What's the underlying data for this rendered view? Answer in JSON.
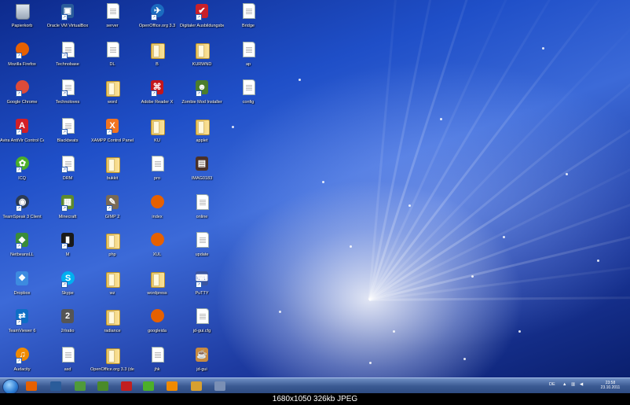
{
  "desktop": {
    "icons": [
      {
        "label": "Papierkorb",
        "type": "recycle",
        "color": "#9aa7b8"
      },
      {
        "label": "Mozilla Firefox",
        "type": "circ",
        "color": "#e66000",
        "glyph": "",
        "shortcut": true
      },
      {
        "label": "Google Chrome",
        "type": "circ",
        "color": "#dd4b39",
        "glyph": "",
        "shortcut": true
      },
      {
        "label": "Avira AntiVir Control Center",
        "type": "sq",
        "color": "#d31f26",
        "glyph": "A",
        "shortcut": true
      },
      {
        "label": "ICQ",
        "type": "circ",
        "color": "#4caf2a",
        "glyph": "✿",
        "shortcut": true
      },
      {
        "label": "TeamSpeak 3 Client",
        "type": "circ",
        "color": "#2b3b55",
        "glyph": "◉",
        "shortcut": true
      },
      {
        "label": "NetbeansLL",
        "type": "sq",
        "color": "#3a8c3a",
        "glyph": "◆",
        "shortcut": true
      },
      {
        "label": "Dropbox",
        "type": "sq",
        "color": "#3d8be0",
        "glyph": "❖",
        "shortcut": false
      },
      {
        "label": "TeamViewer 6",
        "type": "sq",
        "color": "#0e6ec6",
        "glyph": "⇄",
        "shortcut": true
      },
      {
        "label": "Audacity",
        "type": "circ",
        "color": "#f08a00",
        "glyph": "♫",
        "shortcut": true
      },
      {
        "label": "Oracle VM VirtualBox",
        "type": "sq",
        "color": "#2a5c9a",
        "glyph": "▣",
        "shortcut": true
      },
      {
        "label": "Technobase",
        "type": "doc",
        "color": "#ffffff",
        "shortcut": true
      },
      {
        "label": "Technoloves",
        "type": "doc",
        "color": "#ffffff",
        "shortcut": true
      },
      {
        "label": "Blackbeats",
        "type": "doc",
        "color": "#ffffff",
        "shortcut": true
      },
      {
        "label": "DRM",
        "type": "doc",
        "color": "#ffffff",
        "shortcut": true
      },
      {
        "label": "Minecraft",
        "type": "sq",
        "color": "#5d8a2e",
        "glyph": "▦",
        "shortcut": true
      },
      {
        "label": "M",
        "type": "sq",
        "color": "#1a1a1a",
        "glyph": "▮",
        "shortcut": true
      },
      {
        "label": "Skype",
        "type": "circ",
        "color": "#00aff0",
        "glyph": "S",
        "shortcut": true
      },
      {
        "label": "2rlratio",
        "type": "sq",
        "color": "#555555",
        "glyph": "2",
        "shortcut": false
      },
      {
        "label": "asd",
        "type": "doc",
        "color": "#ffffff",
        "shortcut": false
      },
      {
        "label": "server",
        "type": "doc",
        "color": "#ffffff",
        "shortcut": false
      },
      {
        "label": "DL",
        "type": "doc",
        "color": "#ffffff",
        "shortcut": false
      },
      {
        "label": "word",
        "type": "folder",
        "color": "#e9c560"
      },
      {
        "label": "XAMPP Control Panel",
        "type": "sq",
        "color": "#f37420",
        "glyph": "X",
        "shortcut": true
      },
      {
        "label": "bukkit",
        "type": "folder",
        "color": "#e9c560"
      },
      {
        "label": "GIMP 2",
        "type": "sq",
        "color": "#7a6a55",
        "glyph": "✎",
        "shortcut": true
      },
      {
        "label": "php",
        "type": "folder",
        "color": "#e9c560"
      },
      {
        "label": "wz",
        "type": "folder",
        "color": "#e9c560"
      },
      {
        "label": "radiance",
        "type": "folder",
        "color": "#e9c560"
      },
      {
        "label": "OpenOffice.org 3.3 (de) Installation Files",
        "type": "folder",
        "color": "#e9c560"
      },
      {
        "label": "OpenOffice.org 3.3",
        "type": "circ",
        "color": "#1b6bbf",
        "glyph": "✈",
        "shortcut": true
      },
      {
        "label": "B",
        "type": "folder",
        "color": "#e9c560"
      },
      {
        "label": "Adobe Reader X",
        "type": "sq",
        "color": "#c4161c",
        "glyph": "⌘",
        "shortcut": true
      },
      {
        "label": "KU",
        "type": "folder",
        "color": "#e9c560"
      },
      {
        "label": "pro",
        "type": "doc",
        "color": "#ffffff",
        "shortcut": false
      },
      {
        "label": "index",
        "type": "circ",
        "color": "#e66000",
        "glyph": "",
        "shortcut": false
      },
      {
        "label": "XUL",
        "type": "circ",
        "color": "#e66000",
        "glyph": "",
        "shortcut": false
      },
      {
        "label": "wordpress",
        "type": "folder",
        "color": "#e9c560"
      },
      {
        "label": "googleida",
        "type": "circ",
        "color": "#e66000",
        "glyph": "",
        "shortcut": false
      },
      {
        "label": "jhk",
        "type": "doc",
        "color": "#ffffff",
        "shortcut": false
      },
      {
        "label": "Digitaler Ausbildungsbericht...",
        "type": "sq",
        "color": "#c8202a",
        "glyph": "✔",
        "shortcut": true
      },
      {
        "label": "KURWND",
        "type": "folder",
        "color": "#e9c560"
      },
      {
        "label": "Zombie Mod Installer",
        "type": "sq",
        "color": "#4b7d2c",
        "glyph": "☻",
        "shortcut": true
      },
      {
        "label": "applet",
        "type": "folder",
        "color": "#e9c560"
      },
      {
        "label": "IMAG0183",
        "type": "sq",
        "color": "#4a3028",
        "glyph": "▤",
        "shortcut": false
      },
      {
        "label": "online",
        "type": "doc",
        "color": "#ffffff",
        "shortcut": false
      },
      {
        "label": "update",
        "type": "doc",
        "color": "#ffffff",
        "shortcut": false
      },
      {
        "label": "PuTTY",
        "type": "sq",
        "color": "#3a55a0",
        "glyph": "⌨",
        "shortcut": true
      },
      {
        "label": "jd-gui.cfg",
        "type": "doc",
        "color": "#ffffff",
        "shortcut": false
      },
      {
        "label": "jd-gui",
        "type": "sq",
        "color": "#c88a40",
        "glyph": "☕",
        "shortcut": false
      },
      {
        "label": "Bridge",
        "type": "doc",
        "color": "#ffffff",
        "shortcut": false
      },
      {
        "label": "ap",
        "type": "doc",
        "color": "#ffffff",
        "shortcut": false
      },
      {
        "label": "config",
        "type": "doc",
        "color": "#ffffff",
        "shortcut": false
      }
    ]
  },
  "taskbar": {
    "pinned": [
      {
        "name": "firefox-taskbar-icon",
        "color": "#e66000"
      },
      {
        "name": "virtualbox-taskbar-icon",
        "color": "#2a5c9a"
      },
      {
        "name": "notepadpp-taskbar-icon",
        "color": "#4f9a3a"
      },
      {
        "name": "mspaint-taskbar-icon",
        "color": "#4a8a2a"
      },
      {
        "name": "filezilla-taskbar-icon",
        "color": "#c21f1f"
      },
      {
        "name": "icq-taskbar-icon",
        "color": "#4caf2a"
      },
      {
        "name": "media-player-taskbar-icon",
        "color": "#f08a00"
      },
      {
        "name": "users-taskbar-icon",
        "color": "#d8a030"
      },
      {
        "name": "paint-taskbar-icon",
        "color": "#7a8fb5"
      }
    ],
    "language": "DE",
    "time": "23:58",
    "date": "23.10.2011"
  },
  "caption": "1680x1050  326kb  JPEG"
}
